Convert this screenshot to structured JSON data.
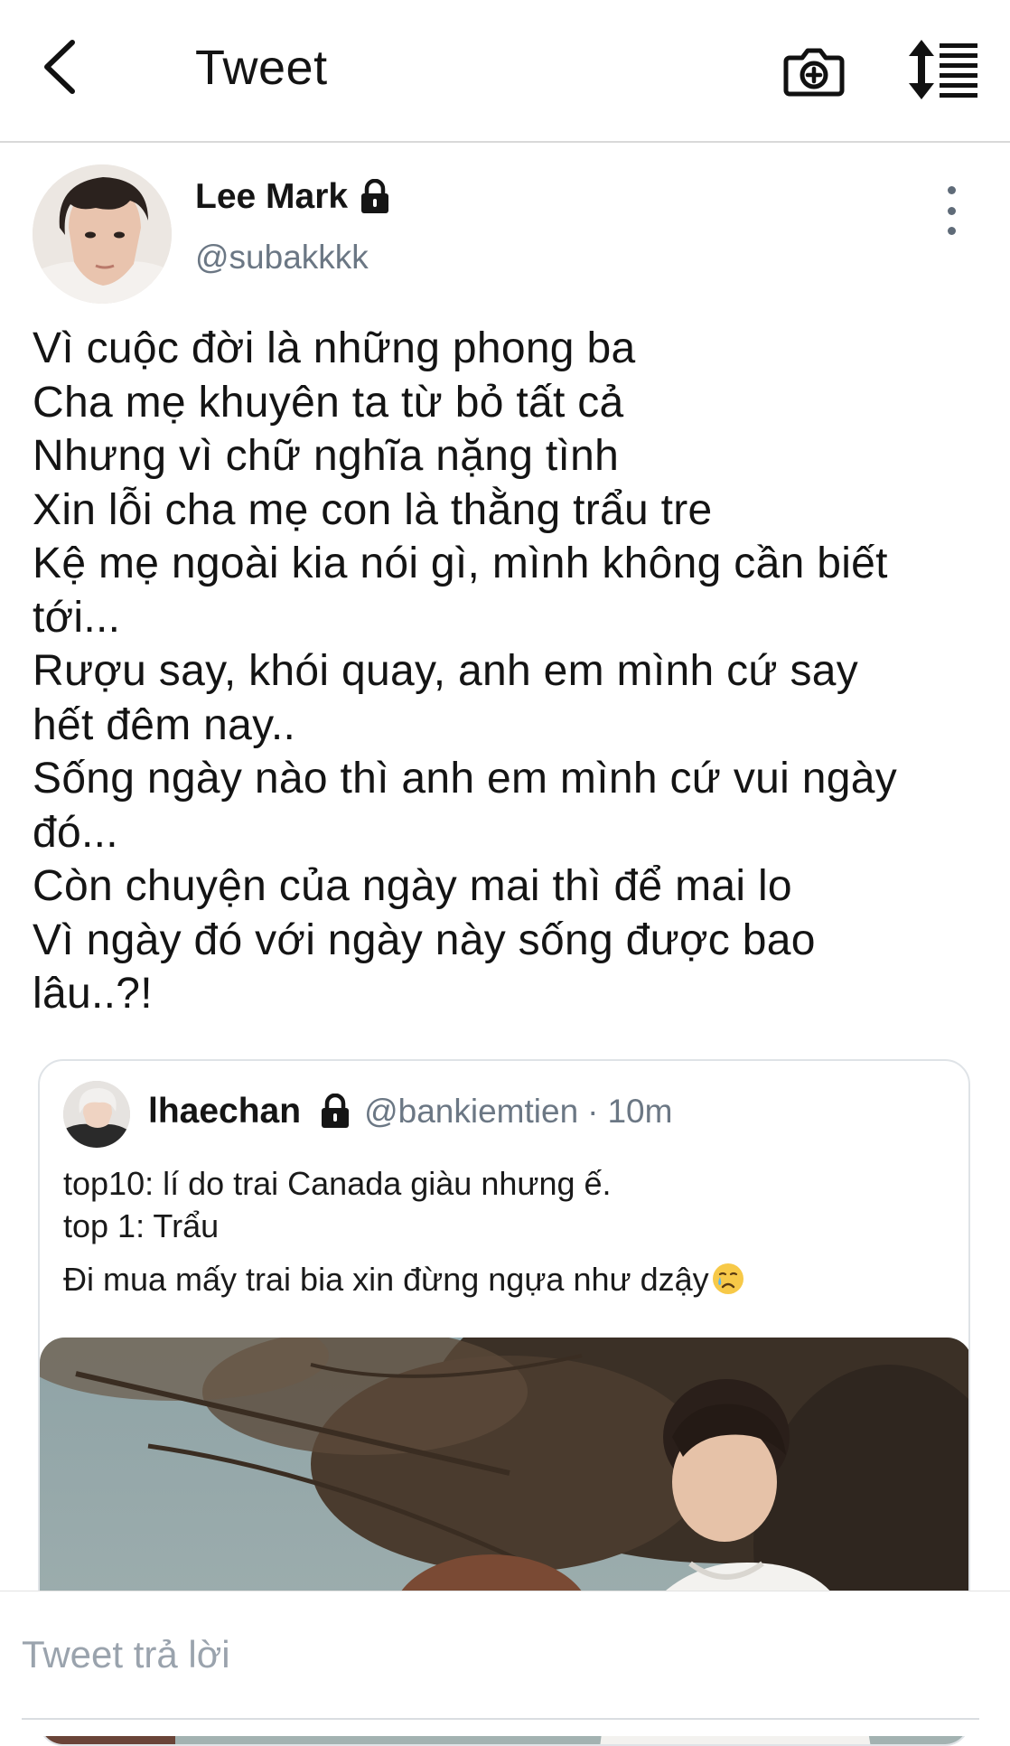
{
  "header": {
    "title": "Tweet",
    "back_icon": "chevron-left-icon",
    "camera_icon": "camera-plus-icon",
    "sort_icon": "sort-lines-icon"
  },
  "tweet": {
    "author_name": "Lee Mark",
    "author_handle": "@subakkkk",
    "protected_icon": "lock-icon",
    "more_icon": "more-vertical-icon",
    "lines": [
      "Vì cuộc đời là những phong ba",
      "Cha mẹ khuyên ta từ bỏ tất cả",
      "Nhưng vì chữ nghĩa nặng tình",
      "Xin lỗi cha mẹ con là thằng trẩu tre",
      "Kệ mẹ ngoài kia nói gì, mình không cần biết",
      "tới...",
      "Rượu say, khói quay, anh em mình cứ say",
      "hết đêm nay..",
      "Sống ngày nào thì anh em mình cứ vui ngày",
      "đó...",
      "Còn chuyện của ngày mai thì để mai lo",
      "Vì ngày đó với ngày này sống được bao",
      "lâu..?!"
    ]
  },
  "quoted": {
    "name": "lhaechan",
    "handle": "@bankiemtien",
    "separator": "·",
    "time": "10m",
    "line1": "top10: lí do trai Canada giàu nhưng ế.",
    "line2": "top 1: Trẩu",
    "line3": "Đi mua mấy trai bia xin đừng ngựa như dzậy",
    "emoji_icon": "crying-face-emoji-icon"
  },
  "reply": {
    "placeholder": "Tweet trả lời"
  },
  "colors": {
    "text_primary": "#141414",
    "text_secondary": "#6b7784",
    "divider": "#d9d9d9",
    "card_border": "#dfe3e7"
  }
}
